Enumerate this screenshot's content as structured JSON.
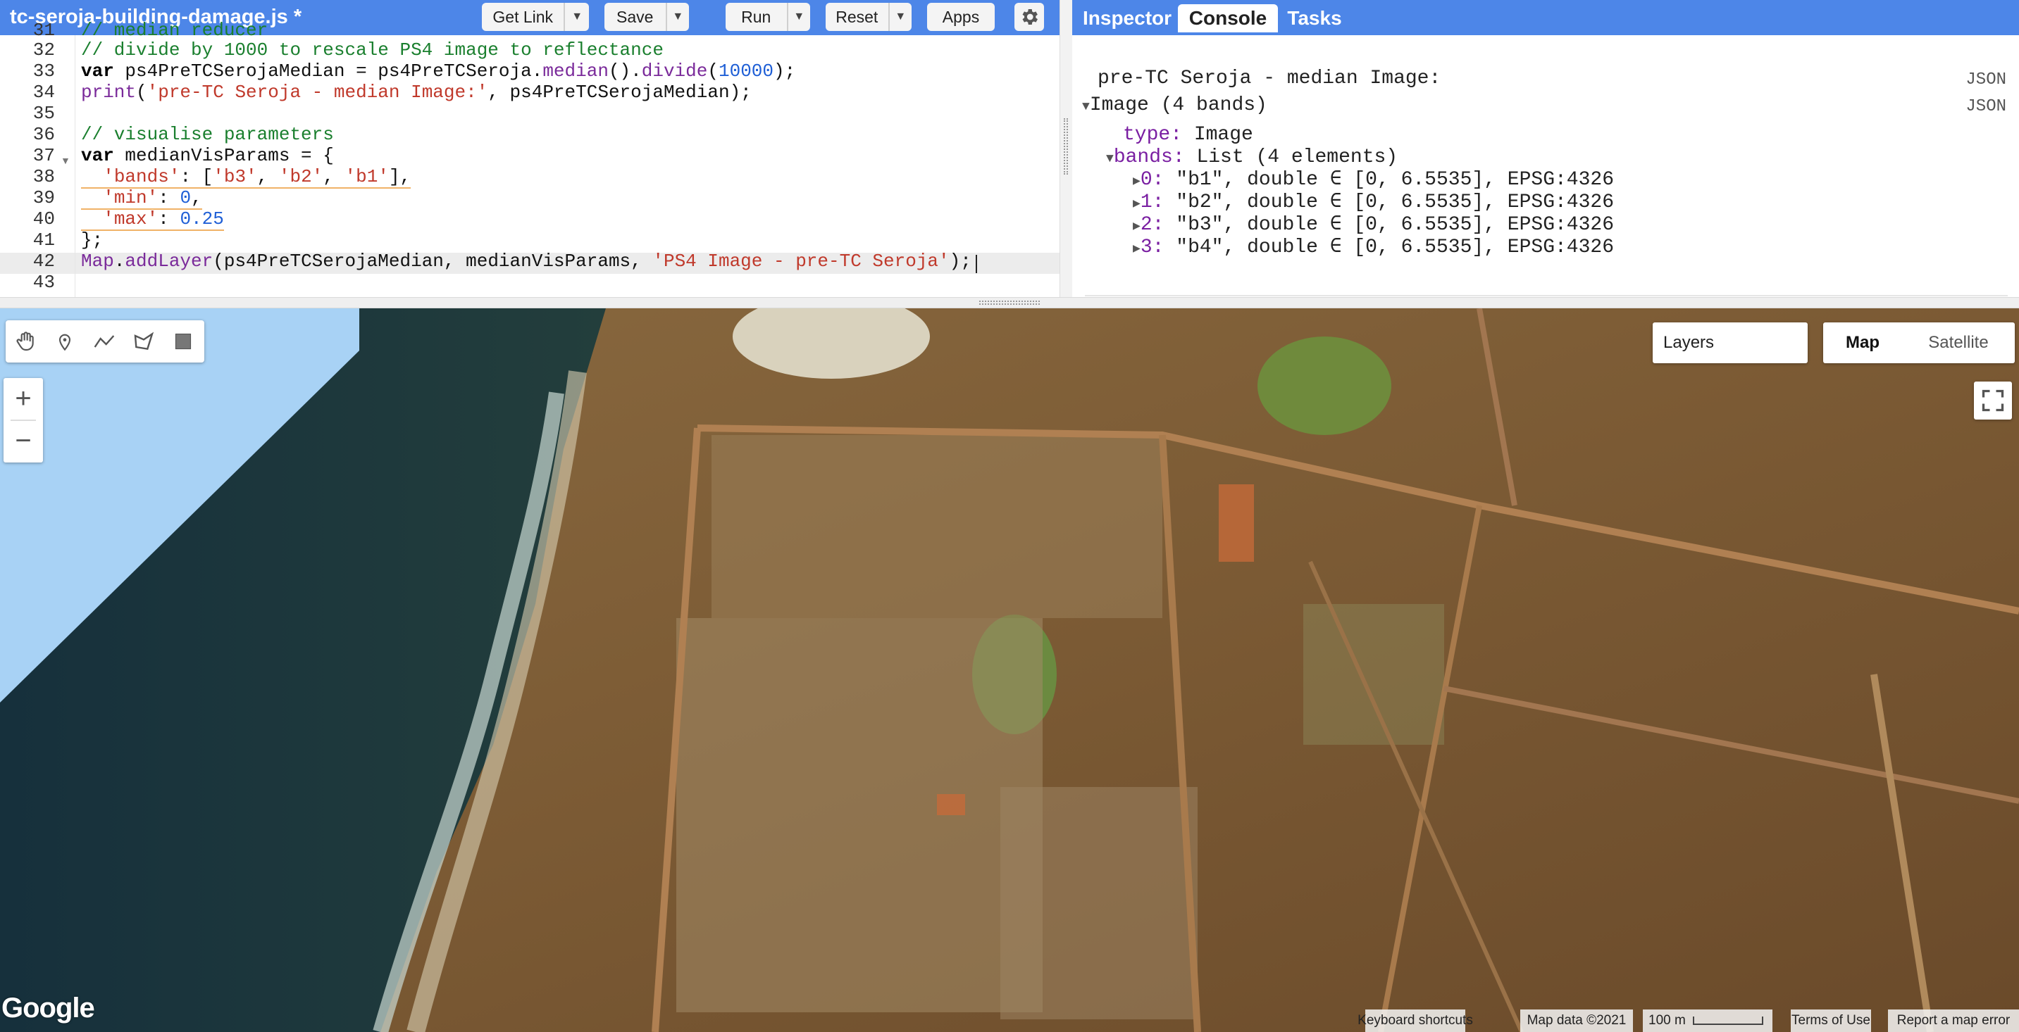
{
  "editor": {
    "file_name": "tc-seroja-building-damage.js *",
    "buttons": {
      "get_link": "Get Link",
      "save": "Save",
      "run": "Run",
      "reset": "Reset",
      "apps": "Apps"
    },
    "lines": [
      {
        "n": "31",
        "tokens": [
          {
            "t": "// median reducer",
            "c": "cm"
          }
        ]
      },
      {
        "n": "32",
        "tokens": [
          {
            "t": "// divide by 1000 to rescale PS4 image to reflectance",
            "c": "cm"
          }
        ]
      },
      {
        "n": "33",
        "tokens": [
          {
            "t": "var",
            "c": "kw"
          },
          {
            "t": " ps4PreTCSerojaMedian = ps4PreTCSeroja.",
            "c": "pl"
          },
          {
            "t": "median",
            "c": "fn"
          },
          {
            "t": "().",
            "c": "pl"
          },
          {
            "t": "divide",
            "c": "fn"
          },
          {
            "t": "(",
            "c": "pl"
          },
          {
            "t": "10000",
            "c": "num"
          },
          {
            "t": ");",
            "c": "pl"
          }
        ]
      },
      {
        "n": "34",
        "tokens": [
          {
            "t": "print",
            "c": "fn"
          },
          {
            "t": "(",
            "c": "pl"
          },
          {
            "t": "'pre-TC Seroja - median Image:'",
            "c": "str"
          },
          {
            "t": ", ps4PreTCSerojaMedian);",
            "c": "pl"
          }
        ]
      },
      {
        "n": "35",
        "tokens": []
      },
      {
        "n": "36",
        "tokens": [
          {
            "t": "// visualise parameters",
            "c": "cm"
          }
        ]
      },
      {
        "n": "37",
        "tokens": [
          {
            "t": "var",
            "c": "kw"
          },
          {
            "t": " medianVisParams = {",
            "c": "pl"
          }
        ]
      },
      {
        "n": "38",
        "tokens": [
          {
            "t": "  ",
            "c": "pl"
          },
          {
            "t": "'bands'",
            "c": "str"
          },
          {
            "t": ": [",
            "c": "pl"
          },
          {
            "t": "'b3'",
            "c": "str"
          },
          {
            "t": ", ",
            "c": "pl"
          },
          {
            "t": "'b2'",
            "c": "str"
          },
          {
            "t": ", ",
            "c": "pl"
          },
          {
            "t": "'b1'",
            "c": "str"
          },
          {
            "t": "],",
            "c": "pl"
          }
        ]
      },
      {
        "n": "39",
        "tokens": [
          {
            "t": "  ",
            "c": "pl"
          },
          {
            "t": "'min'",
            "c": "str"
          },
          {
            "t": ": ",
            "c": "pl"
          },
          {
            "t": "0",
            "c": "num"
          },
          {
            "t": ",",
            "c": "pl"
          }
        ]
      },
      {
        "n": "40",
        "tokens": [
          {
            "t": "  ",
            "c": "pl"
          },
          {
            "t": "'max'",
            "c": "str"
          },
          {
            "t": ": ",
            "c": "pl"
          },
          {
            "t": "0.25",
            "c": "num"
          }
        ]
      },
      {
        "n": "41",
        "tokens": [
          {
            "t": "};",
            "c": "pl"
          }
        ]
      },
      {
        "n": "42",
        "tokens": [
          {
            "t": "Map",
            "c": "fn"
          },
          {
            "t": ".",
            "c": "pl"
          },
          {
            "t": "addLayer",
            "c": "fn"
          },
          {
            "t": "(ps4PreTCSerojaMedian, medianVisParams, ",
            "c": "pl"
          },
          {
            "t": "'PS4 Image - pre-TC Seroja'",
            "c": "str"
          },
          {
            "t": ");",
            "c": "pl"
          }
        ]
      },
      {
        "n": "43",
        "tokens": []
      }
    ]
  },
  "right_panel": {
    "tabs": [
      "Inspector",
      "Console",
      "Tasks"
    ],
    "active_tab": "Console",
    "console": {
      "print_label": "pre-TC Seroja - median Image:",
      "json_link": "JSON",
      "image_label": "Image (4 bands)",
      "type_key": "type:",
      "type_value": "Image",
      "bands_key": "bands:",
      "bands_value": "List (4 elements)",
      "bands": [
        {
          "idx": "0:",
          "desc": "\"b1\", double ∈ [0, 6.5535], EPSG:4326"
        },
        {
          "idx": "1:",
          "desc": "\"b2\", double ∈ [0, 6.5535], EPSG:4326"
        },
        {
          "idx": "2:",
          "desc": "\"b3\", double ∈ [0, 6.5535], EPSG:4326"
        },
        {
          "idx": "3:",
          "desc": "\"b4\", double ∈ [0, 6.5535], EPSG:4326"
        }
      ]
    }
  },
  "map": {
    "layers_label": "Layers",
    "map_type_map": "Map",
    "map_type_satellite": "Satellite",
    "active_map_type": "Map",
    "zoom_in": "+",
    "zoom_out": "−",
    "google_logo": "Google",
    "attribution": {
      "keyboard": "Keyboard shortcuts",
      "map_data": "Map data ©2021",
      "scale": "100 m",
      "terms": "Terms of Use",
      "report": "Report a map error"
    },
    "tools": [
      "hand-icon",
      "marker-icon",
      "polyline-icon",
      "polygon-icon",
      "rectangle-icon"
    ]
  },
  "colors": {
    "header_blue": "#4d86e8",
    "ocean": "#a8d2f5"
  }
}
